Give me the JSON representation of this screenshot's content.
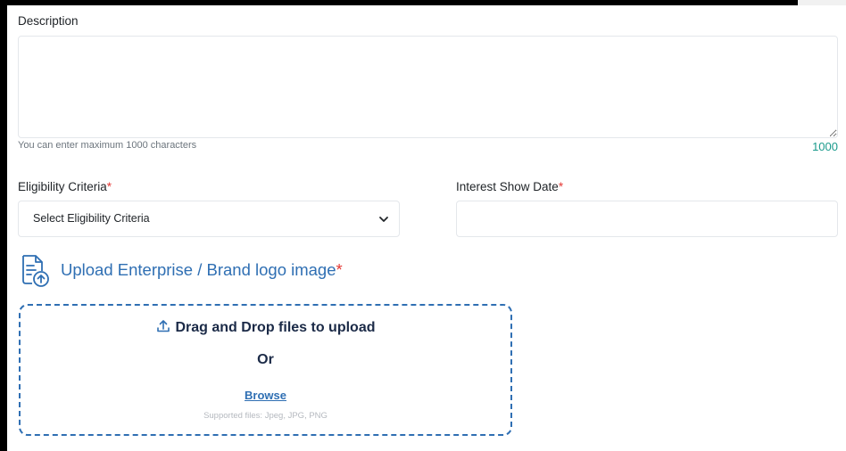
{
  "description": {
    "label": "Description",
    "value": "",
    "hint": "You can enter maximum 1000 characters",
    "remaining": "1000"
  },
  "eligibility": {
    "label": "Eligibility Criteria",
    "required_mark": "*",
    "selected": "Select Eligibility Criteria"
  },
  "interest_date": {
    "label": "Interest Show Date",
    "required_mark": "*",
    "value": ""
  },
  "upload": {
    "title": "Upload Enterprise / Brand logo image",
    "required_mark": "*",
    "drag_text": "Drag and Drop files to upload",
    "or_text": "Or",
    "browse_label": "Browse",
    "supported": "Supported files: Jpeg, JPG, PNG"
  },
  "colors": {
    "accent": "#2f6fb3",
    "required": "#e53935",
    "counter": "#1a9a8c"
  }
}
